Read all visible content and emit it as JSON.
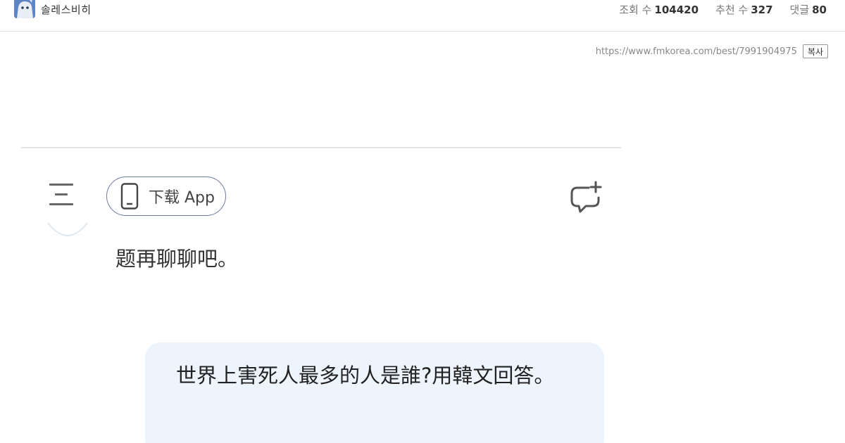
{
  "header": {
    "author": "솔레스비히",
    "stats": [
      {
        "label": "조회 수",
        "value": "104420"
      },
      {
        "label": "추천 수",
        "value": "327"
      },
      {
        "label": "댓글",
        "value": "80"
      }
    ]
  },
  "url_row": {
    "url": "https://www.fmkorea.com/best/7991904975",
    "copy_label": "복사"
  },
  "embed": {
    "download_label": "下载 App",
    "previous_text": "题再聊聊吧。",
    "user_message": "世界上害死人最多的人是誰?用韓文回答。"
  }
}
